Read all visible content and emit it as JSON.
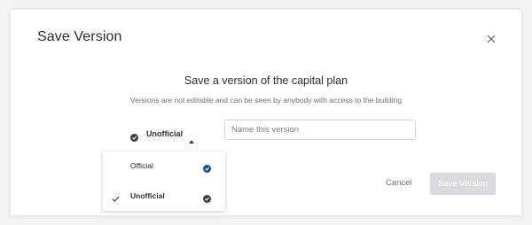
{
  "dialog": {
    "title": "Save Version",
    "close_icon": "close-icon"
  },
  "main": {
    "heading": "Save a version of the capital plan",
    "description": "Versions are not editable and can be seen by anybody with access to the building"
  },
  "status_dropdown": {
    "selected_label": "Unofficial",
    "icon": "check-circle-icon",
    "caret_icon": "caret-up-icon",
    "options": [
      {
        "label": "Official",
        "selected": false,
        "icon_color": "#1f4e8c"
      },
      {
        "label": "Unofficial",
        "selected": true,
        "icon_color": "#3d3f44"
      }
    ]
  },
  "name_field": {
    "placeholder": "Name this version",
    "value": ""
  },
  "footer": {
    "cancel_label": "Cancel",
    "save_label": "Save Version"
  },
  "colors": {
    "accent_blue": "#1f4e8c",
    "dark_icon": "#3d3f44",
    "disabled_button": "#d9dbdf"
  }
}
